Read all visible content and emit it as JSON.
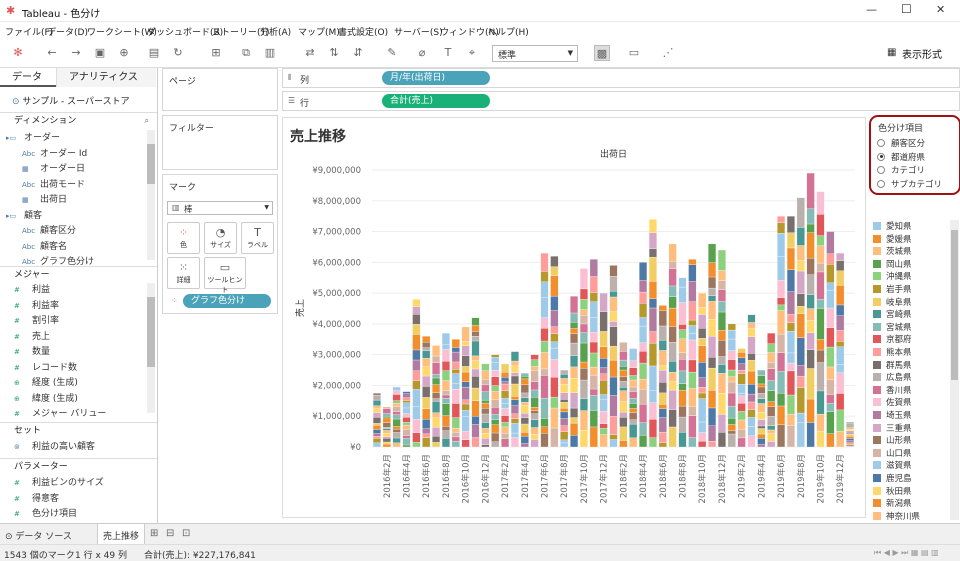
{
  "window": {
    "title": "Tableau - 色分け",
    "minimize": "—",
    "maximize": "☐",
    "close": "✕"
  },
  "menu": [
    "ファイル(F)",
    "データ(D)",
    "ワークシート(W)",
    "ダッシュボード(B)",
    "ストーリー(T)",
    "分析(A)",
    "マップ(M)",
    "書式設定(O)",
    "サーバー(S)",
    "ウィンドウ(N)",
    "ヘルプ(H)"
  ],
  "toolbar": {
    "fit_value": "標準",
    "show_me": "表示形式"
  },
  "left": {
    "tab_data": "データ",
    "tab_analytics": "アナリティクス",
    "datasource": "サンプル - スーパーストア",
    "dimensions_header": "ディメンション",
    "dimensions": [
      {
        "label": "オーダー",
        "kind": "folder"
      },
      {
        "label": "オーダー Id",
        "kind": "abc"
      },
      {
        "label": "オーダー日",
        "kind": "date"
      },
      {
        "label": "出荷モード",
        "kind": "abc"
      },
      {
        "label": "出荷日",
        "kind": "date"
      },
      {
        "label": "顧客",
        "kind": "folder"
      },
      {
        "label": "顧客区分",
        "kind": "abc"
      },
      {
        "label": "顧客名",
        "kind": "abc"
      },
      {
        "label": "グラフ色分け",
        "kind": "abc"
      }
    ],
    "measures_header": "メジャー",
    "measures": [
      {
        "label": "利益",
        "kind": "#"
      },
      {
        "label": "利益率",
        "kind": "#"
      },
      {
        "label": "割引率",
        "kind": "#"
      },
      {
        "label": "売上",
        "kind": "#"
      },
      {
        "label": "数量",
        "kind": "#"
      },
      {
        "label": "レコード数",
        "kind": "#"
      },
      {
        "label": "経度 (生成)",
        "kind": "geo"
      },
      {
        "label": "緯度 (生成)",
        "kind": "geo"
      },
      {
        "label": "メジャー バリュー",
        "kind": "#"
      }
    ],
    "sets_header": "セット",
    "sets": [
      {
        "label": "利益の高い顧客"
      }
    ],
    "params_header": "パラメーター",
    "params": [
      {
        "label": "利益ビンのサイズ"
      },
      {
        "label": "得意客"
      },
      {
        "label": "色分け項目"
      }
    ]
  },
  "shelves": {
    "pages": "ページ",
    "filters": "フィルター",
    "marks": "マーク",
    "mark_type": "棒",
    "mark_buttons": [
      "色",
      "サイズ",
      "ラベル",
      "詳細",
      "ツールヒント"
    ],
    "color_pill": "グラフ色分け",
    "columns_label": "列",
    "columns_pill": "月/年(出荷日)",
    "rows_label": "行",
    "rows_pill": "合計(売上)"
  },
  "colors": {
    "pill_blue": "#4aa3b8",
    "pill_green": "#1ab179",
    "accent_red": "#a01010"
  },
  "param_control": {
    "title": "色分け項目",
    "options": [
      "顧客区分",
      "都道府県",
      "カテゴリ",
      "サブカテゴリ"
    ],
    "selected": "都道府県"
  },
  "legend": [
    {
      "label": "愛知県",
      "color": "#9ecae9"
    },
    {
      "label": "愛媛県",
      "color": "#f28e2b"
    },
    {
      "label": "茨城県",
      "color": "#ffbe7d"
    },
    {
      "label": "岡山県",
      "color": "#59a14f"
    },
    {
      "label": "沖縄県",
      "color": "#8cd17d"
    },
    {
      "label": "岩手県",
      "color": "#b6992d"
    },
    {
      "label": "岐阜県",
      "color": "#f1ce63"
    },
    {
      "label": "宮崎県",
      "color": "#499894"
    },
    {
      "label": "宮城県",
      "color": "#86bcb6"
    },
    {
      "label": "京都府",
      "color": "#e15759"
    },
    {
      "label": "熊本県",
      "color": "#ff9d9a"
    },
    {
      "label": "群馬県",
      "color": "#79706e"
    },
    {
      "label": "広島県",
      "color": "#bab0ac"
    },
    {
      "label": "香川県",
      "color": "#d37295"
    },
    {
      "label": "佐賀県",
      "color": "#fabfd2"
    },
    {
      "label": "埼玉県",
      "color": "#b07aa1"
    },
    {
      "label": "三重県",
      "color": "#d4a6c8"
    },
    {
      "label": "山形県",
      "color": "#9d7660"
    },
    {
      "label": "山口県",
      "color": "#d7b5a6"
    },
    {
      "label": "滋賀県",
      "color": "#a0cbe8"
    },
    {
      "label": "鹿児島",
      "color": "#4e79a7"
    },
    {
      "label": "秋田県",
      "color": "#ffd86b"
    },
    {
      "label": "新潟県",
      "color": "#f28e2b"
    },
    {
      "label": "神奈川県",
      "color": "#ffbe7d"
    }
  ],
  "chart_data": {
    "type": "bar",
    "title": "売上推移",
    "xlabel": "出荷日",
    "ylabel": "売上",
    "ylim": [
      0,
      9000000
    ],
    "y_ticks": [
      "¥9,000,000",
      "¥8,000,000",
      "¥7,000,000",
      "¥6,000,000",
      "¥5,000,000",
      "¥4,000,000",
      "¥3,000,000",
      "¥2,000,000",
      "¥1,000,000",
      "¥0"
    ],
    "categories": [
      "2016年1月",
      "2016年2月",
      "2016年3月",
      "2016年4月",
      "2016年5月",
      "2016年6月",
      "2016年7月",
      "2016年8月",
      "2016年9月",
      "2016年10月",
      "2016年11月",
      "2016年12月",
      "2017年1月",
      "2017年2月",
      "2017年3月",
      "2017年4月",
      "2017年5月",
      "2017年6月",
      "2017年7月",
      "2017年8月",
      "2017年9月",
      "2017年10月",
      "2017年11月",
      "2017年12月",
      "2018年1月",
      "2018年2月",
      "2018年3月",
      "2018年4月",
      "2018年5月",
      "2018年6月",
      "2018年7月",
      "2018年8月",
      "2018年9月",
      "2018年10月",
      "2018年11月",
      "2018年12月",
      "2019年1月",
      "2019年2月",
      "2019年3月",
      "2019年4月",
      "2019年5月",
      "2019年6月",
      "2019年7月",
      "2019年8月",
      "2019年9月",
      "2019年10月",
      "2019年11月",
      "2019年12月",
      "2020年1月"
    ],
    "x_tick_labels": [
      "2016年2月",
      "2016年4月",
      "2016年6月",
      "2016年8月",
      "2016年10月",
      "2016年12月",
      "2017年2月",
      "2017年4月",
      "2017年6月",
      "2017年8月",
      "2017年10月",
      "2017年12月",
      "2018年2月",
      "2018年4月",
      "2018年6月",
      "2018年8月",
      "2018年10月",
      "2018年12月",
      "2019年2月",
      "2019年4月",
      "2019年6月",
      "2019年8月",
      "2019年10月",
      "2019年12月"
    ],
    "values": [
      1750000,
      1300000,
      1950000,
      1800000,
      4800000,
      3600000,
      3300000,
      3700000,
      3500000,
      3900000,
      4200000,
      2700000,
      3000000,
      2700000,
      3100000,
      2400000,
      3000000,
      6300000,
      6200000,
      2500000,
      4900000,
      5800000,
      6100000,
      5000000,
      5900000,
      3400000,
      3200000,
      6000000,
      7400000,
      4600000,
      6600000,
      5500000,
      6100000,
      5000000,
      6600000,
      6400000,
      4000000,
      3200000,
      4300000,
      2500000,
      3700000,
      7500000,
      7500000,
      8100000,
      8900000,
      8300000,
      7000000,
      6300000,
      800000
    ]
  },
  "tabs": {
    "datasource": "データ ソース",
    "sheet": "売上推移"
  },
  "status": {
    "marks": "1543 個のマーク",
    "dims": "1 行 x 49 列",
    "sum": "合計(売上): ¥227,176,841"
  }
}
